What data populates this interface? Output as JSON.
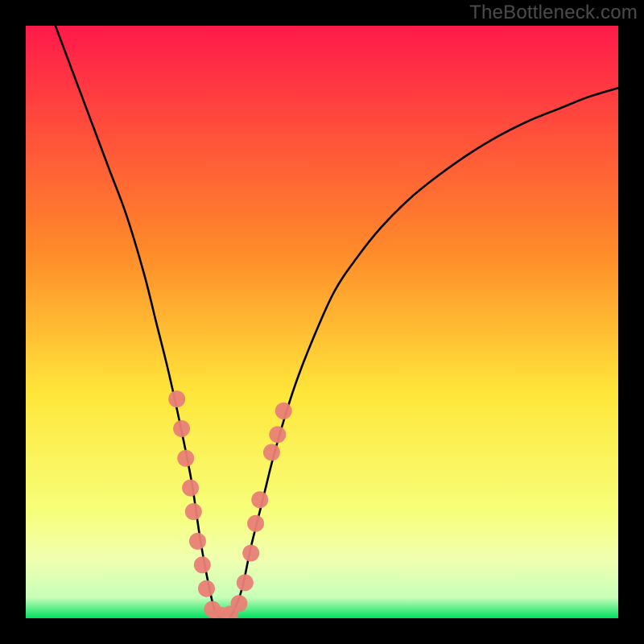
{
  "watermark": "TheBottleneck.com",
  "colors": {
    "frame": "#000000",
    "gradient_top": "#ff1a4a",
    "gradient_mid1": "#ff8a2a",
    "gradient_mid2": "#ffe63a",
    "gradient_mid3": "#f7ff7a",
    "gradient_band": "#f0ffb0",
    "gradient_green": "#00e060",
    "curve": "#000000",
    "dot": "#e98076"
  },
  "chart_data": {
    "type": "line",
    "title": "",
    "xlabel": "",
    "ylabel": "",
    "xlim": [
      0,
      100
    ],
    "ylim": [
      0,
      100
    ],
    "series": [
      {
        "name": "bottleneck-curve",
        "x": [
          5,
          8,
          11,
          14,
          17,
          20,
          22,
          24,
          26,
          28,
          29.5,
          31,
          32,
          33,
          34,
          35,
          36.5,
          38,
          40,
          42,
          45,
          48,
          52,
          56,
          60,
          65,
          70,
          75,
          80,
          85,
          90,
          95,
          100
        ],
        "y": [
          100,
          92,
          84,
          76,
          68,
          58,
          50,
          42,
          33,
          23,
          13,
          5,
          1,
          0,
          0,
          1,
          5,
          12,
          20,
          28,
          38,
          46,
          55,
          61,
          66,
          71,
          75,
          78.5,
          81.5,
          84,
          86,
          88,
          89.5
        ]
      }
    ],
    "dots": {
      "name": "sample-points",
      "points": [
        {
          "x": 25.5,
          "y": 37
        },
        {
          "x": 26.3,
          "y": 32
        },
        {
          "x": 27.0,
          "y": 27
        },
        {
          "x": 27.8,
          "y": 22
        },
        {
          "x": 28.3,
          "y": 18
        },
        {
          "x": 29.0,
          "y": 13
        },
        {
          "x": 29.8,
          "y": 9
        },
        {
          "x": 30.5,
          "y": 5
        },
        {
          "x": 31.5,
          "y": 1.5
        },
        {
          "x": 33.0,
          "y": 0.5
        },
        {
          "x": 34.5,
          "y": 0.7
        },
        {
          "x": 36.0,
          "y": 2.5
        },
        {
          "x": 37.0,
          "y": 6
        },
        {
          "x": 38.0,
          "y": 11
        },
        {
          "x": 38.8,
          "y": 16
        },
        {
          "x": 39.5,
          "y": 20
        },
        {
          "x": 41.5,
          "y": 28
        },
        {
          "x": 42.5,
          "y": 31
        },
        {
          "x": 43.5,
          "y": 35
        }
      ]
    }
  }
}
